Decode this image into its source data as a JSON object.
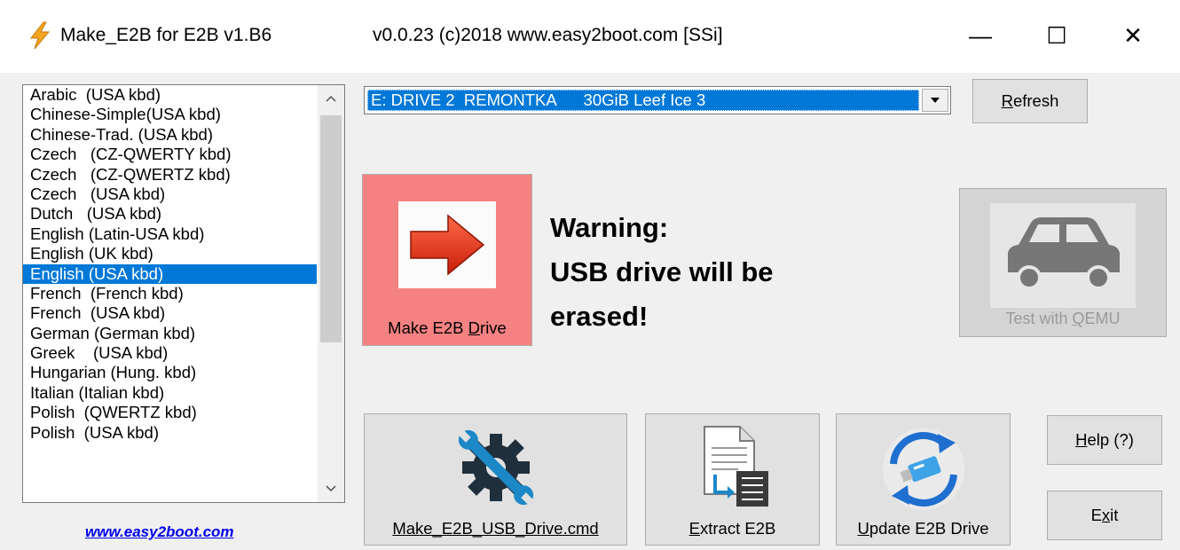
{
  "titlebar": {
    "app_title": "Make_E2B for E2B v1.B6",
    "version_text": "v0.0.23  (c)2018 www.easy2boot.com [SSi]",
    "icon": "lightning-icon",
    "minimize_glyph": "—",
    "maximize_glyph": "☐",
    "close_glyph": "✕"
  },
  "language_list": {
    "items": [
      "Arabic  (USA kbd)",
      "Chinese-Simple(USA kbd)",
      "Chinese-Trad. (USA kbd)",
      "Czech   (CZ-QWERTY kbd)",
      "Czech   (CZ-QWERTZ kbd)",
      "Czech   (USA kbd)",
      "Dutch   (USA kbd)",
      "English (Latin-USA kbd)",
      "English (UK kbd)",
      "English (USA kbd)",
      "French  (French kbd)",
      "French  (USA kbd)",
      "German (German kbd)",
      "Greek    (USA kbd)",
      "Hungarian (Hung. kbd)",
      "Italian (Italian kbd)",
      "Polish  (QWERTZ kbd)",
      "Polish  (USA kbd)"
    ],
    "selected_index": 9
  },
  "website_link": "www.easy2boot.com",
  "drive_select": {
    "value": "E: DRIVE 2  REMONTKA      30GiB Leef Ice 3"
  },
  "refresh_button": {
    "label": "Refresh",
    "mnemonic": "R",
    "rest": "efresh"
  },
  "make_drive_button": {
    "label_pre": "Make E2B ",
    "label_mn": "D",
    "label_post": "rive",
    "icon": "arrow-right-icon"
  },
  "warning": {
    "line1": "Warning:",
    "line2": "USB drive will be",
    "line3": "erased!"
  },
  "qemu_button": {
    "label_pre": "Test with ",
    "label_mn": "Q",
    "label_post": "EMU",
    "icon": "car-icon"
  },
  "cmd_button": {
    "label": "Make_E2B_USB_Drive.cmd",
    "icon": "wrench-gear-icon"
  },
  "extract_button": {
    "label_mn": "E",
    "label_post": "xtract E2B",
    "icon": "document-extract-icon"
  },
  "update_button": {
    "label_mn": "U",
    "label_post": "pdate E2B Drive",
    "icon": "usb-sync-icon"
  },
  "help_button": {
    "label_mn": "H",
    "label_post": "elp (?)"
  },
  "exit_button": {
    "label_pre": "E",
    "label_mn": "x",
    "label_post": "it"
  },
  "colors": {
    "selection": "#0078d7",
    "make_drive_bg": "#f48282",
    "link": "#0000ee"
  }
}
